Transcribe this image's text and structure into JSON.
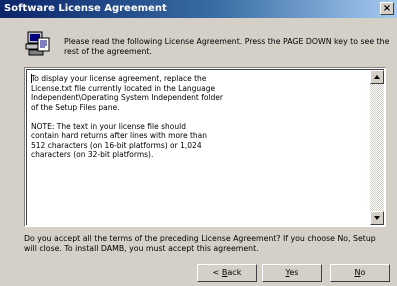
{
  "window": {
    "title": "Software License Agreement",
    "close_glyph": "×"
  },
  "header": {
    "instruction": "Please read the following License Agreement.  Press the PAGE DOWN key to see the rest of the agreement."
  },
  "license": {
    "paragraphs": [
      "To display your license agreement, replace the\nLicense.txt file currently located in the Language\nIndependent\\Operating System Independent folder\nof the Setup Files pane.",
      "NOTE: The text in your license file should\ncontain hard returns after lines with more than\n512 characters (on 16-bit platforms) or 1,024\ncharacters (on 32-bit platforms)."
    ]
  },
  "question": "Do you accept all the terms of the preceding License Agreement?  If you choose No,  Setup will close.  To install DAMB, you must accept this agreement.",
  "buttons": {
    "back": {
      "prefix": "< ",
      "mnemonic": "B",
      "rest": "ack"
    },
    "yes": {
      "mnemonic": "Y",
      "rest": "es"
    },
    "no": {
      "mnemonic": "N",
      "rest": "o"
    }
  },
  "icons": {
    "header": "computer-install-icon",
    "close": "close-icon",
    "scroll_up": "scroll-up-arrow-icon",
    "scroll_down": "scroll-down-arrow-icon"
  }
}
